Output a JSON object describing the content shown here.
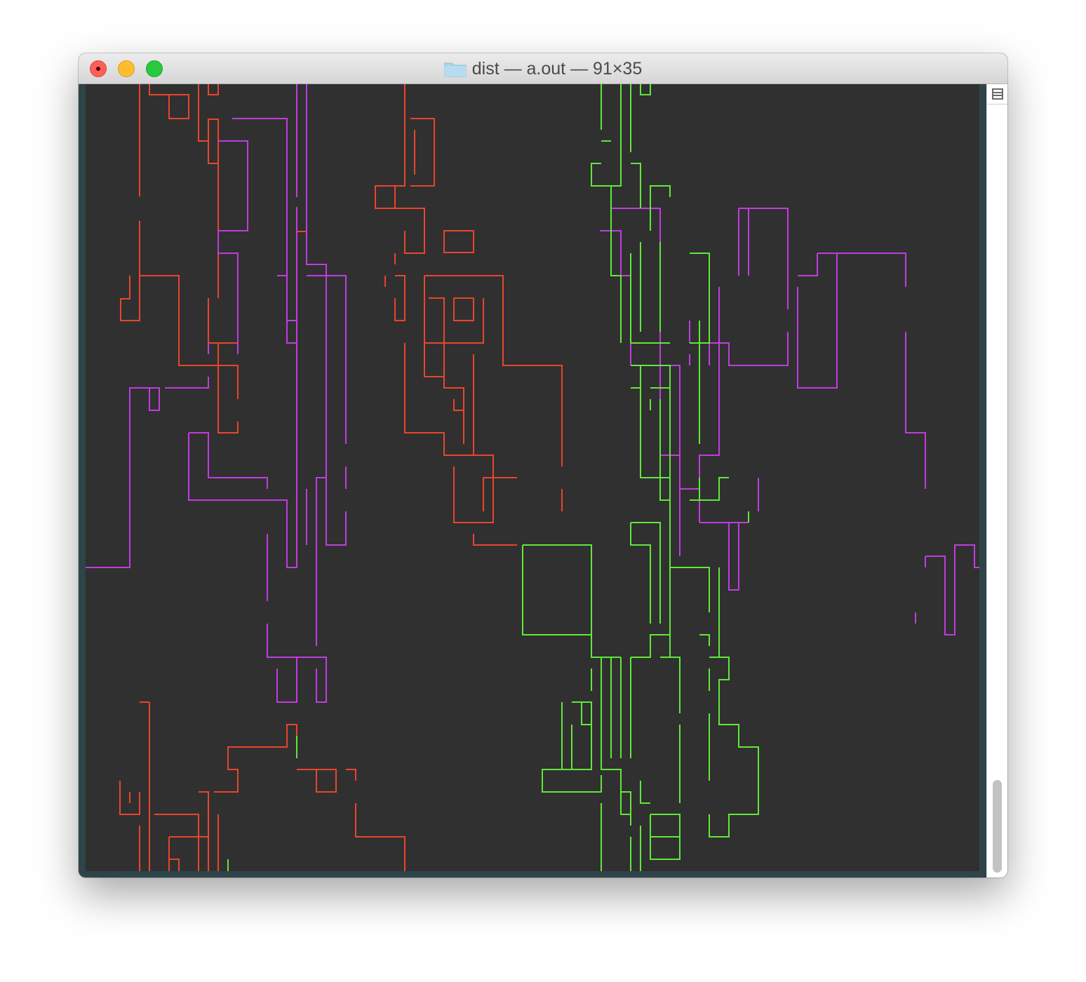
{
  "window": {
    "title": "dist — a.out — 91×35",
    "folder_icon": "folder-icon",
    "buttons": {
      "close": "close-button",
      "minimize": "minimize-button",
      "zoom": "zoom-button"
    }
  },
  "colors": {
    "terminal_background": "#303030",
    "pipe_red": "#e8452c",
    "pipe_purple": "#c03ce0",
    "pipe_green": "#5fe83a",
    "folder_blue": "#a8d4ee"
  },
  "scrollbar": {
    "split_icon": "split-pane-icon"
  }
}
